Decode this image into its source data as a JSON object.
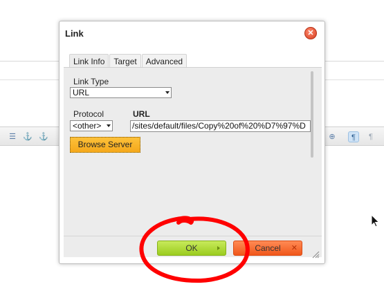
{
  "dialog": {
    "title": "Link",
    "close_icon": "close-icon",
    "tabs": [
      {
        "label": "Link Info",
        "active": true
      },
      {
        "label": "Target",
        "active": false
      },
      {
        "label": "Advanced",
        "active": false
      }
    ],
    "link_type": {
      "label": "Link Type",
      "value": "URL"
    },
    "protocol": {
      "label": "Protocol",
      "value": "<other>"
    },
    "url": {
      "label": "URL",
      "value": "/sites/default/files/Copy%20of%20%D7%97%D"
    },
    "browse_server_label": "Browse Server",
    "ok_label": "OK",
    "cancel_label": "Cancel"
  },
  "toolbar_icons": [
    "list-icon",
    "anchor-icon",
    "unlink-icon",
    "crosshair-icon",
    "ltr-icon",
    "rtl-icon"
  ],
  "colors": {
    "ok_green": "#b3dc3a",
    "cancel_orange": "#f46a2e",
    "browse_orange": "#f9b52a",
    "annotation_red": "#ff0000"
  }
}
